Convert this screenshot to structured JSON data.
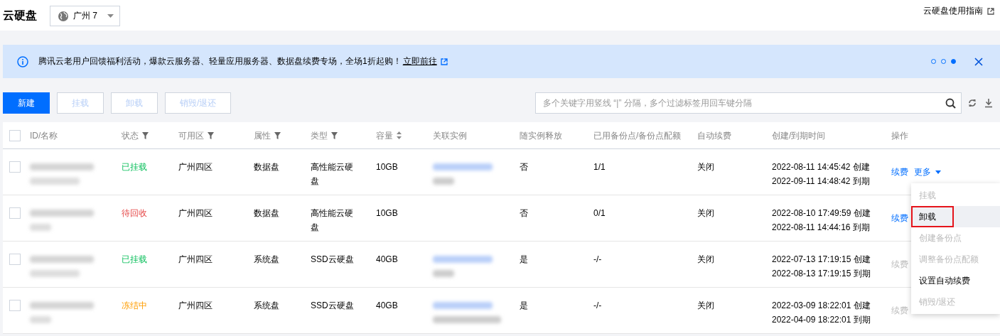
{
  "header": {
    "title": "云硬盘",
    "region": "广州 7",
    "guide_link": "云硬盘使用指南"
  },
  "banner": {
    "text": "腾讯云老用户回馈福利活动，爆款云服务器、轻量应用服务器、数据盘续费专场，全场1折起购！",
    "link": "立即前往",
    "dots": [
      {
        "selected": false
      },
      {
        "selected": false
      },
      {
        "selected": true
      }
    ]
  },
  "toolbar": {
    "buttons": [
      {
        "label": "新建",
        "kind": "primary"
      },
      {
        "label": "挂载",
        "kind": "disabled"
      },
      {
        "label": "卸载",
        "kind": "disabled"
      },
      {
        "label": "销毁/退还",
        "kind": "disabled"
      }
    ],
    "search": {
      "placeholder": "多个关键字用竖线 “|” 分隔，多个过滤标签用回车键分隔"
    }
  },
  "table": {
    "select_all_checked": false,
    "columns": [
      {
        "label": "ID/名称",
        "kind": "plain"
      },
      {
        "label": "状态",
        "kind": "filter"
      },
      {
        "label": "可用区",
        "kind": "filter"
      },
      {
        "label": "属性",
        "kind": "filter"
      },
      {
        "label": "类型",
        "kind": "filter"
      },
      {
        "label": "容量",
        "kind": "sort"
      },
      {
        "label": "关联实例",
        "kind": "plain"
      },
      {
        "label": "随实例释放",
        "kind": "plain"
      },
      {
        "label": "已用备份点/备份点配额",
        "kind": "plain"
      },
      {
        "label": "自动续费",
        "kind": "plain"
      },
      {
        "label": "创建/到期时间",
        "kind": "plain"
      },
      {
        "label": "操作",
        "kind": "plain"
      }
    ],
    "rows": [
      {
        "checked": false,
        "status": "已挂载",
        "kind": "mounted",
        "zone": "广州四区",
        "attribute": "数据盘",
        "type": "高性能云硬盘",
        "capacity": "10GB",
        "instance_blurred": true,
        "release": "否",
        "backup": "1/1",
        "auto_renew": "关闭",
        "created": "2022-08-11 14:45:42 创建",
        "expires": "2022-09-11 14:48:42 到期",
        "renew": {
          "label": "续费",
          "disabled": false
        },
        "more": "更多"
      },
      {
        "checked": false,
        "status": "待回收",
        "kind": "pending",
        "zone": "广州四区",
        "attribute": "数据盘",
        "type": "高性能云硬盘",
        "capacity": "10GB",
        "instance_blurred": false,
        "release": "否",
        "backup": "0/1",
        "auto_renew": "关闭",
        "created": "2022-08-10 17:49:59 创建",
        "expires": "2022-08-11 14:44:16 到期",
        "renew": {
          "label": "续费",
          "disabled": false
        }
      },
      {
        "checked": false,
        "status": "已挂载",
        "kind": "mounted",
        "zone": "广州四区",
        "attribute": "系统盘",
        "type": "SSD云硬盘",
        "capacity": "40GB",
        "instance_blurred": true,
        "release": "是",
        "backup": "-/-",
        "auto_renew": "关闭",
        "created": "2022-07-13 17:19:15 创建",
        "expires": "2022-08-13 17:19:15 到期",
        "renew": {
          "label": "续费",
          "disabled": true
        }
      },
      {
        "checked": false,
        "status": "冻结中",
        "kind": "frozen",
        "zone": "广州四区",
        "attribute": "系统盘",
        "type": "SSD云硬盘",
        "capacity": "40GB",
        "instance_blurred": true,
        "release": "是",
        "backup": "-/-",
        "auto_renew": "关闭",
        "created": "2022-03-09 18:22:01 创建",
        "expires": "2022-04-09 18:22:01 到期",
        "renew": {
          "label": "续费",
          "disabled": true
        }
      }
    ]
  },
  "menu": {
    "items": [
      {
        "label": "挂载",
        "disabled": true,
        "highlighted": false
      },
      {
        "label": "卸载",
        "disabled": false,
        "highlighted": true
      },
      {
        "label": "创建备份点",
        "disabled": true,
        "highlighted": false
      },
      {
        "label": "调整备份点配额",
        "disabled": true,
        "highlighted": false
      },
      {
        "label": "设置自动续费",
        "disabled": false,
        "highlighted": false
      },
      {
        "label": "销毁/退还",
        "disabled": true,
        "highlighted": false
      }
    ]
  }
}
